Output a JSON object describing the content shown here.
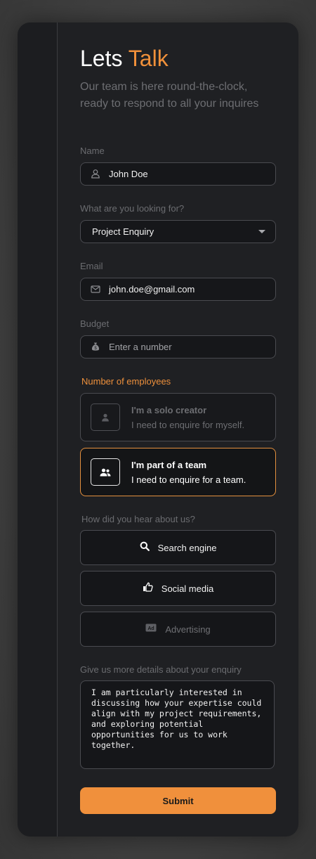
{
  "header": {
    "title_plain": "Lets",
    "title_accent": "Talk",
    "subtitle": "Our team is here round-the-clock, ready to respond to all your inquires"
  },
  "form": {
    "name": {
      "label": "Name",
      "value": "John Doe",
      "icon": "user-icon"
    },
    "looking_for": {
      "label": "What are you looking for?",
      "value": "Project Enquiry"
    },
    "email": {
      "label": "Email",
      "value": "john.doe@gmail.com",
      "icon": "mail-icon"
    },
    "budget": {
      "label": "Budget",
      "placeholder": "Enter a number",
      "icon": "money-bag-icon"
    },
    "employees": {
      "label": "Number of employees",
      "options": [
        {
          "title": "I'm a solo creator",
          "desc": "I need to enquire for myself.",
          "icon": "user-icon",
          "selected": false
        },
        {
          "title": "I'm part of a team",
          "desc": "I need to enquire for a team.",
          "icon": "users-icon",
          "selected": true
        }
      ]
    },
    "source": {
      "label": "How did you hear about us?",
      "options": [
        {
          "label": "Search engine",
          "icon": "search-icon"
        },
        {
          "label": "Social media",
          "icon": "thumbs-up-icon"
        },
        {
          "label": "Advertising",
          "icon": "ad-icon"
        }
      ]
    },
    "details": {
      "label": "Give us more details about your enquiry",
      "value": "I am particularly interested in discussing how your expertise could align with my project requirements, and exploring potential opportunities for us to work together."
    },
    "submit_label": "Submit"
  },
  "colors": {
    "accent": "#f0903c",
    "card_background": "#1f2023",
    "border": "#4a4b50"
  }
}
